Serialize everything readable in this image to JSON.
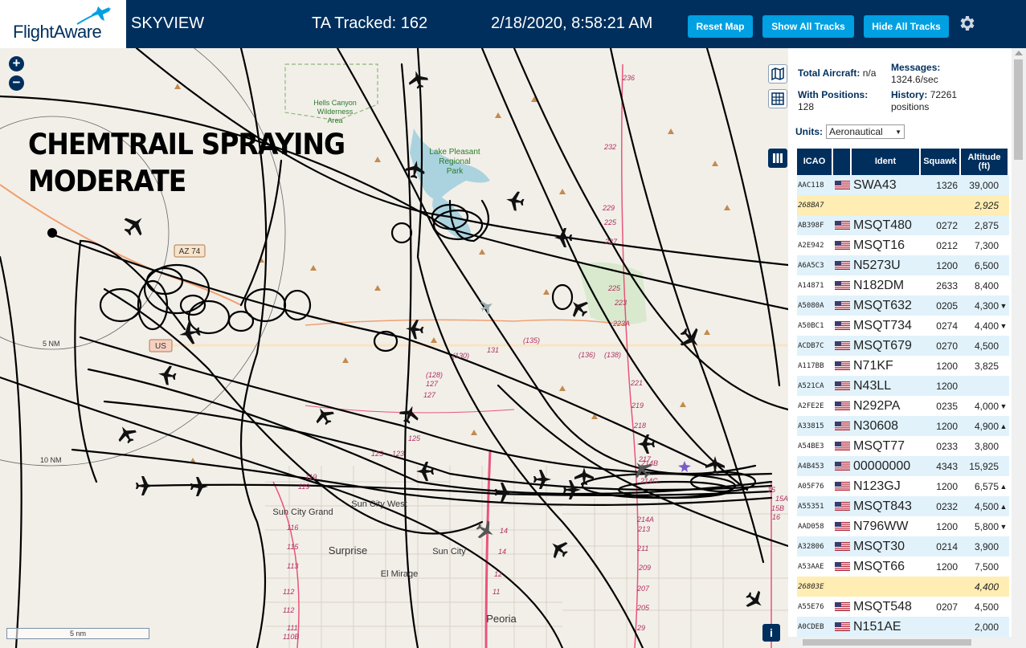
{
  "header": {
    "logo_text": "FlightAware",
    "app_title": "SKYVIEW",
    "tracked": "TA Tracked: 162",
    "datetime": "2/18/2020, 8:58:21 AM",
    "buttons": {
      "reset": "Reset Map",
      "show_all": "Show All Tracks",
      "hide_all": "Hide All Tracks"
    },
    "brand_color": "#002f5d",
    "button_color": "#00a0e2"
  },
  "map": {
    "overlay_line1": "CHEMTRAIL SPRAYING",
    "overlay_line2": "MODERATE",
    "zoom_in": "+",
    "zoom_out": "−",
    "scale_label": "5 nm",
    "ring_labels": [
      "5 NM",
      "10 NM"
    ],
    "places": [
      "Hells Canyon",
      "Wilderness",
      "Area",
      "Lake Pleasant",
      "Regional",
      "Park",
      "Sun City Grand",
      "Sun City West",
      "Surprise",
      "Sun City",
      "El Mirage",
      "Peoria"
    ],
    "road_shields": [
      "AZ 74",
      "US"
    ],
    "route_numbers": [
      "236",
      "232",
      "229",
      "225",
      "227",
      "225",
      "223",
      "223A",
      "(130)",
      "131",
      "(135)",
      "(136)",
      "(138)",
      "(128)",
      "127",
      "127",
      "125",
      "123",
      "123",
      "119",
      "119",
      "116",
      "115",
      "113",
      "112",
      "112",
      "111",
      "110B",
      "14",
      "14",
      "12",
      "11",
      "221",
      "219",
      "218",
      "217",
      "214C",
      "214A",
      "214B",
      "213",
      "211",
      "209",
      "207",
      "205",
      "29",
      "15",
      "15A",
      "15B",
      "16"
    ],
    "info_label": "i"
  },
  "panel": {
    "total_aircraft_label": "Total Aircraft:",
    "total_aircraft_value": "n/a",
    "with_positions_label": "With Positions:",
    "with_positions_value": "128",
    "messages_label": "Messages:",
    "messages_value": "1324.6/sec",
    "history_label": "History:",
    "history_value": "72261",
    "history_unit": "positions",
    "units_label": "Units:",
    "units_value": "Aeronautical",
    "columns": [
      "ICAO",
      "",
      "Ident",
      "Squawk",
      "Altitude (ft)"
    ],
    "rows": [
      {
        "icao": "AAC118",
        "flag": true,
        "ident": "SWA43",
        "squawk": "1326",
        "alt": "39,000",
        "trend": "",
        "hl": false
      },
      {
        "icao": "268BA7",
        "flag": false,
        "ident": "",
        "squawk": "",
        "alt": "2,925",
        "trend": "",
        "hl": true
      },
      {
        "icao": "AB398F",
        "flag": true,
        "ident": "MSQT480",
        "squawk": "0272",
        "alt": "2,875",
        "trend": "",
        "hl": false
      },
      {
        "icao": "A2E942",
        "flag": true,
        "ident": "MSQT16",
        "squawk": "0212",
        "alt": "7,300",
        "trend": "",
        "hl": false
      },
      {
        "icao": "A6A5C3",
        "flag": true,
        "ident": "N5273U",
        "squawk": "1200",
        "alt": "6,500",
        "trend": "",
        "hl": false
      },
      {
        "icao": "A14871",
        "flag": true,
        "ident": "N182DM",
        "squawk": "2633",
        "alt": "8,400",
        "trend": "",
        "hl": false
      },
      {
        "icao": "A5080A",
        "flag": true,
        "ident": "MSQT632",
        "squawk": "0205",
        "alt": "4,300",
        "trend": "▼",
        "hl": false
      },
      {
        "icao": "A50BC1",
        "flag": true,
        "ident": "MSQT734",
        "squawk": "0274",
        "alt": "4,400",
        "trend": "▼",
        "hl": false
      },
      {
        "icao": "ACDB7C",
        "flag": true,
        "ident": "MSQT679",
        "squawk": "0270",
        "alt": "4,500",
        "trend": "",
        "hl": false
      },
      {
        "icao": "A117BB",
        "flag": true,
        "ident": "N71KF",
        "squawk": "1200",
        "alt": "3,825",
        "trend": "",
        "hl": false
      },
      {
        "icao": "A521CA",
        "flag": true,
        "ident": "N43LL",
        "squawk": "1200",
        "alt": "",
        "trend": "",
        "hl": false
      },
      {
        "icao": "A2FE2E",
        "flag": true,
        "ident": "N292PA",
        "squawk": "0235",
        "alt": "4,000",
        "trend": "▼",
        "hl": false
      },
      {
        "icao": "A33815",
        "flag": true,
        "ident": "N30608",
        "squawk": "1200",
        "alt": "4,900",
        "trend": "▲",
        "hl": false
      },
      {
        "icao": "A54BE3",
        "flag": true,
        "ident": "MSQT77",
        "squawk": "0233",
        "alt": "3,800",
        "trend": "",
        "hl": false
      },
      {
        "icao": "A4B453",
        "flag": true,
        "ident": "00000000",
        "squawk": "4343",
        "alt": "15,925",
        "trend": "",
        "hl": false
      },
      {
        "icao": "A05F76",
        "flag": true,
        "ident": "N123GJ",
        "squawk": "1200",
        "alt": "6,575",
        "trend": "▲",
        "hl": false
      },
      {
        "icao": "A55351",
        "flag": true,
        "ident": "MSQT843",
        "squawk": "0232",
        "alt": "4,500",
        "trend": "▲",
        "hl": false
      },
      {
        "icao": "AAD058",
        "flag": true,
        "ident": "N796WW",
        "squawk": "1200",
        "alt": "5,800",
        "trend": "▼",
        "hl": false
      },
      {
        "icao": "A32806",
        "flag": true,
        "ident": "MSQT30",
        "squawk": "0214",
        "alt": "3,900",
        "trend": "",
        "hl": false
      },
      {
        "icao": "A53AAE",
        "flag": true,
        "ident": "MSQT66",
        "squawk": "1200",
        "alt": "7,500",
        "trend": "",
        "hl": false
      },
      {
        "icao": "26803E",
        "flag": false,
        "ident": "",
        "squawk": "",
        "alt": "4,400",
        "trend": "",
        "hl": true
      },
      {
        "icao": "A55E76",
        "flag": true,
        "ident": "MSQT548",
        "squawk": "0207",
        "alt": "4,500",
        "trend": "",
        "hl": false
      },
      {
        "icao": "A0CDEB",
        "flag": true,
        "ident": "N151AE",
        "squawk": "",
        "alt": "2,000",
        "trend": "",
        "hl": false
      }
    ]
  }
}
